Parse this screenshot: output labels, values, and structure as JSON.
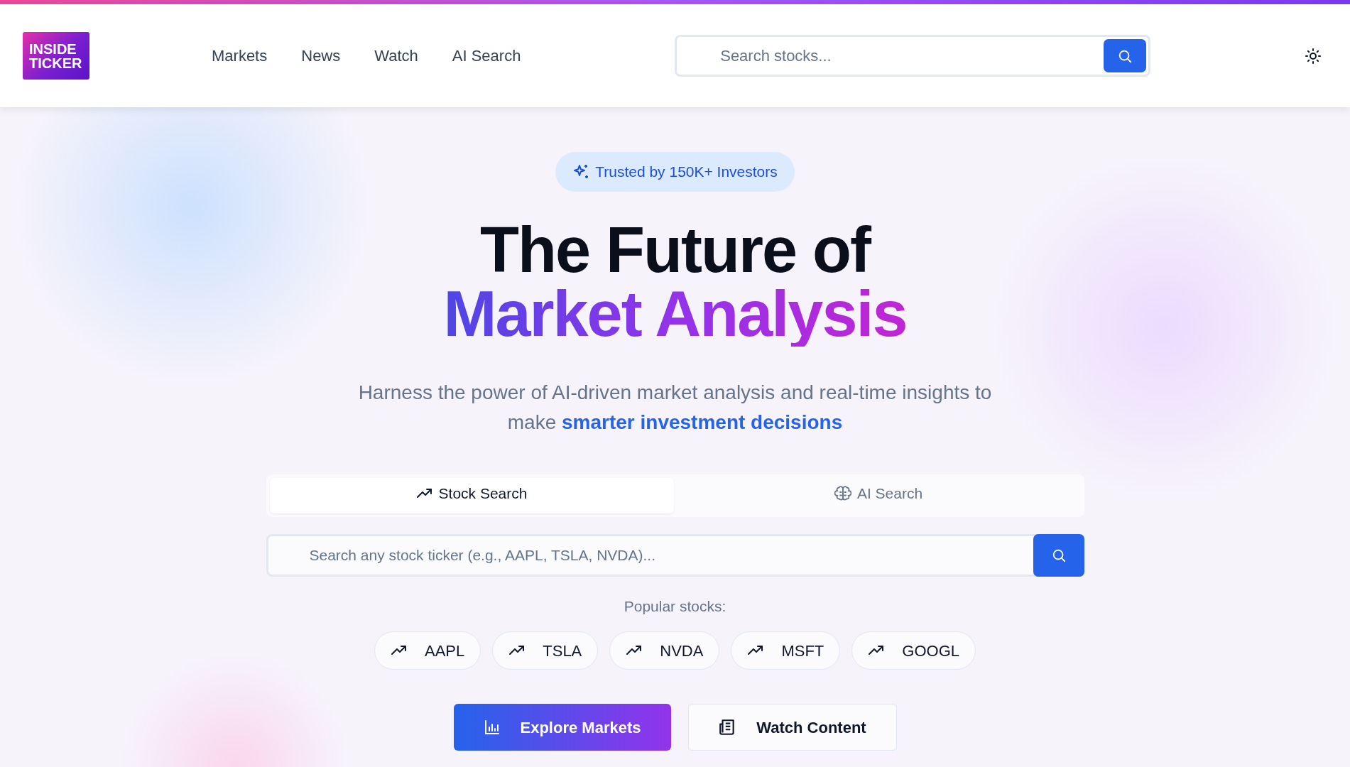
{
  "header": {
    "logo": {
      "line1": "INSIDE",
      "line2": "TICKER"
    },
    "nav": [
      {
        "label": "Markets"
      },
      {
        "label": "News"
      },
      {
        "label": "Watch"
      },
      {
        "label": "AI Search"
      }
    ],
    "search": {
      "placeholder": "Search stocks..."
    }
  },
  "hero": {
    "badge": "Trusted by 150K+ Investors",
    "title_line1": "The Future of",
    "title_line2": "Market Analysis",
    "subtitle": "Harness the power of AI-driven market analysis and real-time insights to make **smarter investment decisions**"
  },
  "search_tabs": [
    {
      "label": "Stock Search",
      "kind": "trend",
      "selected": true
    },
    {
      "label": "AI Search",
      "kind": "brain",
      "selected": false
    }
  ],
  "stock_search": {
    "placeholder": "Search any stock ticker (e.g., AAPL, TSLA, NVDA)..."
  },
  "popular": {
    "label": "Popular stocks:",
    "tickers": [
      "AAPL",
      "TSLA",
      "NVDA",
      "MSFT",
      "GOOGL"
    ]
  },
  "actions": [
    {
      "label": "Explore Markets",
      "kind": "primary"
    },
    {
      "label": "Watch Content",
      "kind": "secondary"
    }
  ]
}
